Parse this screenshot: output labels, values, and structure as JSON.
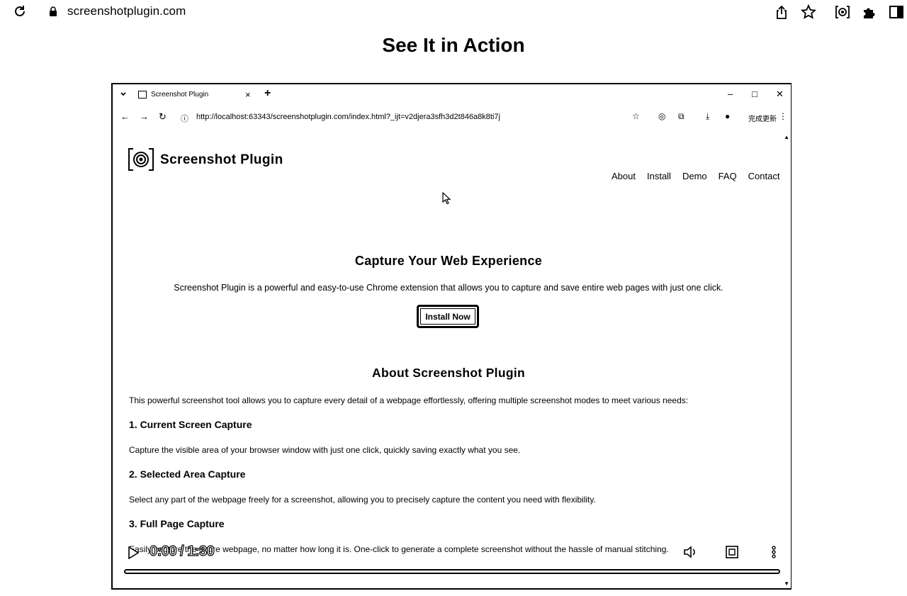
{
  "outer_browser": {
    "url": "screenshotplugin.com",
    "icons": [
      "reload-icon",
      "lock-icon",
      "share-icon",
      "star-icon",
      "screenshot-icon",
      "extensions-icon",
      "sidebar-icon"
    ]
  },
  "page": {
    "title": "See It in Action"
  },
  "video": {
    "inner_browser": {
      "tab_title": "Screenshot Plugin",
      "new_tab_symbol": "+",
      "close_tab_symbol": "×",
      "window_buttons": {
        "minimize": "–",
        "maximize": "□",
        "close": "✕"
      },
      "url": "http://localhost:63343/screenshotplugin.com/index.html?_ijt=v2djera3sfh3d2t846a8k8ti7j",
      "update_label": "完成更新",
      "menu_symbol": "⋮"
    },
    "site": {
      "brand": "Screenshot Plugin",
      "nav": [
        "About",
        "Install",
        "Demo",
        "FAQ",
        "Contact"
      ],
      "hero_title": "Capture Your Web Experience",
      "hero_text": "Screenshot Plugin is a powerful and easy-to-use Chrome extension that allows you to capture and save entire web pages with just one click.",
      "install_button": "Install Now",
      "about_title": "About Screenshot Plugin",
      "about_intro": "This powerful screenshot tool allows you to capture every detail of a webpage effortlessly, offering multiple screenshot modes to meet various needs:",
      "features": [
        {
          "title": "1. Current Screen Capture",
          "text": "Capture the visible area of your browser window with just one click, quickly saving exactly what you see."
        },
        {
          "title": "2. Selected Area Capture",
          "text": "Select any part of the webpage freely for a screenshot, allowing you to precisely capture the content you need with flexibility."
        },
        {
          "title": "3. Full Page Capture",
          "text": "Easily capture the entire webpage, no matter how long it is. One-click to generate a complete screenshot without the hassle of manual stitching."
        }
      ]
    },
    "controls": {
      "time": "0:00 / 1:30",
      "progress": 0
    }
  }
}
